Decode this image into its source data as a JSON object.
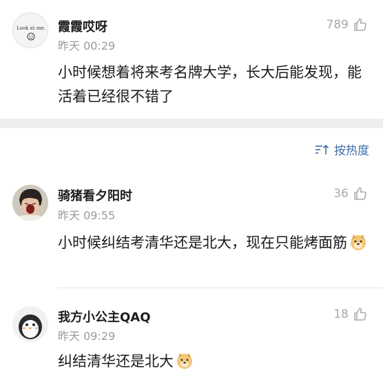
{
  "comments": [
    {
      "user": "霞霞哎呀",
      "time": "昨天 00:29",
      "likes": "789",
      "text": "小时候想着将来考名牌大学，长大后能发现，能活着已经很不错了",
      "avatar": "sketch-face-avatar",
      "avatar_text": "Look at me."
    },
    {
      "user": "骑猪看夕阳时",
      "time": "昨天 09:55",
      "likes": "36",
      "text": "小时候纠结考清华还是北大，现在只能烤面筋",
      "avatar": "shouting-boy-avatar"
    },
    {
      "user": "我方小公主QAQ",
      "time": "昨天 09:29",
      "likes": "18",
      "text": "纠结清华还是北大",
      "avatar": "penguin-avatar"
    }
  ],
  "sort": {
    "label": "按热度",
    "icon": "sort-icon"
  },
  "icons": {
    "like": "thumbs-up-icon",
    "emoji": "doge-emoji-icon"
  },
  "colors": {
    "link": "#3d6ea8",
    "meta": "#9a9a9a",
    "band": "#eeeeee"
  }
}
